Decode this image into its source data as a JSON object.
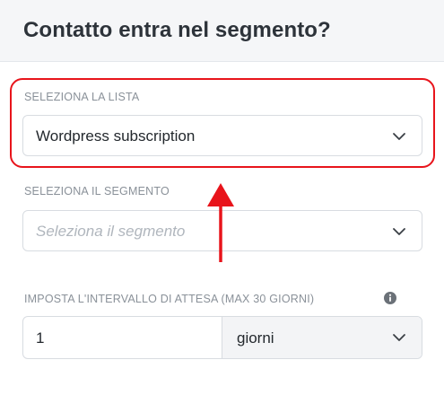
{
  "header": {
    "title": "Contatto entra nel segmento?"
  },
  "list_field": {
    "label": "SELEZIONA LA LISTA",
    "value": "Wordpress subscription",
    "icon": "chevron-down-icon"
  },
  "segment_field": {
    "label": "SELEZIONA IL SEGMENTO",
    "placeholder": "Seleziona il segmento",
    "icon": "chevron-down-icon"
  },
  "interval_field": {
    "label": "IMPOSTA L'INTERVALLO DI ATTESA (MAX 30 GIORNI)",
    "info_icon": "info-icon",
    "value": "1",
    "unit": "giorni",
    "unit_icon": "chevron-down-icon"
  },
  "annotations": {
    "highlight_color": "#e8141b",
    "arrow_color": "#e8141b"
  }
}
